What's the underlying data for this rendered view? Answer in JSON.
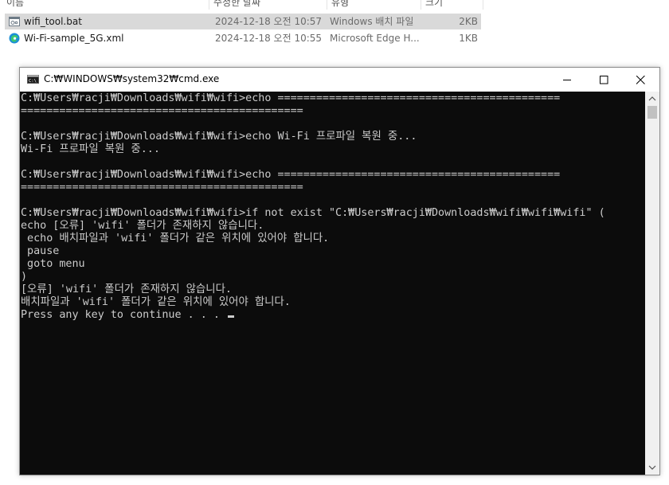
{
  "explorer": {
    "columns": [
      "이름",
      "수정한 날짜",
      "유형",
      "크기"
    ],
    "files": [
      {
        "name": "wifi_tool.bat",
        "date": "2024-12-18 오전 10:57",
        "type": "Windows 배치 파일",
        "size": "2KB",
        "icon": "batch-file-icon",
        "selected": true
      },
      {
        "name": "Wi-Fi-sample_5G.xml",
        "date": "2024-12-18 오전 10:55",
        "type": "Microsoft Edge H...",
        "size": "1KB",
        "icon": "edge-icon",
        "selected": false
      }
    ]
  },
  "cmd": {
    "title": "C:₩WINDOWS₩system32₩cmd.exe",
    "lines": [
      "C:₩Users₩racji₩Downloads₩wifi₩wifi>echo ============================================",
      "============================================",
      "",
      "C:₩Users₩racji₩Downloads₩wifi₩wifi>echo Wi-Fi 프로파일 복원 중...",
      "Wi-Fi 프로파일 복원 중...",
      "",
      "C:₩Users₩racji₩Downloads₩wifi₩wifi>echo ============================================",
      "============================================",
      "",
      "C:₩Users₩racji₩Downloads₩wifi₩wifi>if not exist \"C:₩Users₩racji₩Downloads₩wifi₩wifi₩wifi\" (",
      "echo [오류] 'wifi' 폴더가 존재하지 않습니다.",
      " echo 배치파일과 'wifi' 폴더가 같은 위치에 있어야 합니다.",
      " pause",
      " goto menu",
      ")",
      "[오류] 'wifi' 폴더가 존재하지 않습니다.",
      "배치파일과 'wifi' 폴더가 같은 위치에 있어야 합니다.",
      "Press any key to continue . . . "
    ]
  },
  "colors": {
    "console_bg": "#0c0c0c",
    "console_fg": "#cccccc",
    "selection": "#d9d9d9"
  }
}
